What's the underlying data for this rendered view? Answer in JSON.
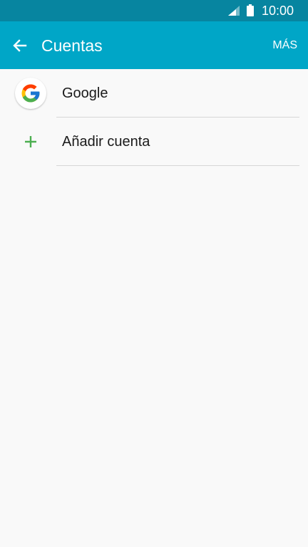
{
  "status_bar": {
    "time": "10:00",
    "icons": [
      "signal-icon",
      "battery-icon"
    ]
  },
  "app_bar": {
    "title": "Cuentas",
    "more_label": "MÁS",
    "back_icon": "arrow-left-icon",
    "color": "#00a6c7",
    "status_color": "#0785a0"
  },
  "accounts": [
    {
      "label": "Google",
      "icon": "google-icon"
    },
    {
      "label": "Añadir cuenta",
      "icon": "plus-icon",
      "icon_color": "#4caf50"
    }
  ]
}
